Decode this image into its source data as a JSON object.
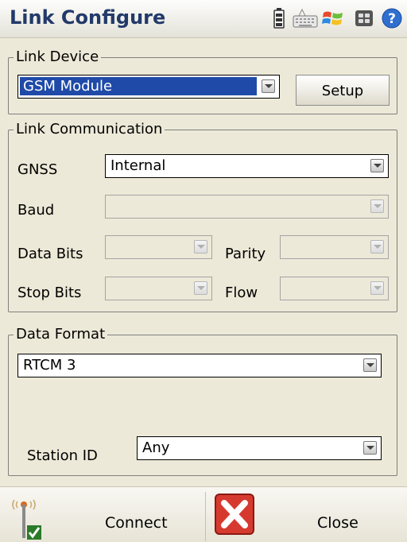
{
  "title": "Link Configure",
  "titlebar_icons": [
    "battery-icon",
    "keyboard-icon",
    "windows-start-icon",
    "task-manager-icon",
    "help-icon"
  ],
  "link_device": {
    "legend": "Link Device",
    "device": "GSM Module",
    "setup_label": "Setup"
  },
  "link_communication": {
    "legend": "Link Communication",
    "gnss_label": "GNSS",
    "gnss_value": "Internal",
    "baud_label": "Baud",
    "baud_value": "",
    "data_bits_label": "Data Bits",
    "data_bits_value": "",
    "parity_label": "Parity",
    "parity_value": "",
    "stop_bits_label": "Stop Bits",
    "stop_bits_value": "",
    "flow_label": "Flow",
    "flow_value": ""
  },
  "data_format": {
    "legend": "Data Format",
    "format_value": "RTCM 3",
    "station_id_label": "Station ID",
    "station_id_value": "Any"
  },
  "bottom_bar": {
    "connect_label": "Connect",
    "close_label": "Close"
  },
  "colors": {
    "title": "#223a6a",
    "selection": "#1f4aa8",
    "background": "#ece9d8",
    "close_red": "#d63a2f"
  }
}
